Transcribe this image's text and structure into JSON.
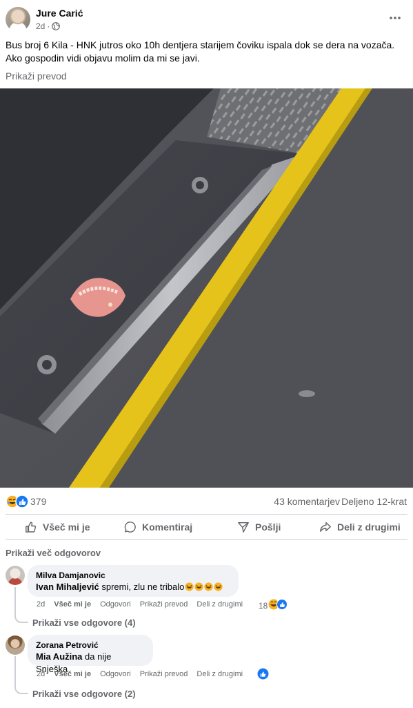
{
  "post": {
    "author": "Jure Carić",
    "age": "2d",
    "text_line1": "Bus broj 6 Kila - HNK jutros oko 10h dentjera starijem čoviku ispala dok se dera na vozača.",
    "text_line2": "Ako gospodin vidi objavu molim da mi se javi.",
    "translate": "Prikaži prevod",
    "photo_icon": "dentures-on-bus-step-photo"
  },
  "stats": {
    "reactions": "379",
    "comments": "43 komentarjev",
    "shares": "Deljeno 12-krat"
  },
  "actions": {
    "like": "Všeč mi je",
    "comment": "Komentiraj",
    "send": "Pošlji",
    "share": "Deli z drugimi"
  },
  "more_replies": "Prikaži več odgovorov",
  "comments": [
    {
      "author": "Milva Damjanovic",
      "mention": "Ivan Mihaljević",
      "text": " spremi, zlu ne tribalo",
      "age": "2d",
      "like": "Všeč mi je",
      "reply": "Odgovori",
      "translate": "Prikaži prevod",
      "share": "Deli z drugimi",
      "reaction_count": "18",
      "view_replies": "Prikaži vse odgovore (4)"
    },
    {
      "author": "Zorana Petrović",
      "mention": "Mia Aužina",
      "text": " da nije Snješka",
      "age": "2d",
      "like": "Všeč mi je",
      "reply": "Odgovori",
      "translate": "Prikaži prevod",
      "share": "Deli z drugimi",
      "reaction_count": "",
      "view_replies": "Prikaži vse odgovore (2)"
    }
  ],
  "colors": {
    "text_primary": "#050505",
    "text_secondary": "#65676b",
    "like_blue": "#1877f2",
    "bubble_bg": "#f0f2f5",
    "divider": "#ced0d4"
  }
}
